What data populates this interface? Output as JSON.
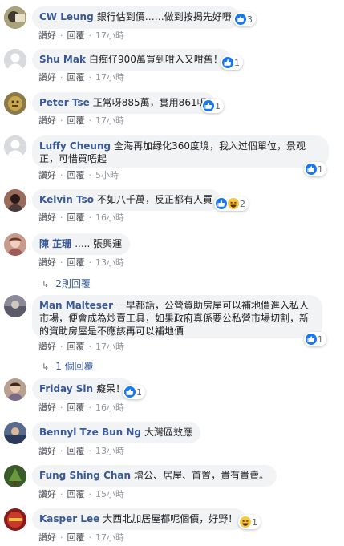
{
  "labels": {
    "like": "讚好",
    "reply": "回覆"
  },
  "comments": [
    {
      "author": "CW Leung",
      "text": "銀行估到價……做到按揭先好嘢",
      "time": "17小時",
      "reaction_count": "3"
    },
    {
      "author": "Shu Mak",
      "text": "白痴仔900萬買到咁入又咁舊！",
      "time": "17小時",
      "reaction_count": "1"
    },
    {
      "author": "Peter Tse",
      "text": "正常呀885萬，實用861呎",
      "time": "17小時",
      "reaction_count": "1"
    },
    {
      "author": "Luffy Cheung",
      "text": "全海再加绿化360度境，我入过個單位，景观正，可惜買唔起",
      "time": "5小時",
      "reaction_count": "1"
    },
    {
      "author": "Kelvin Tso",
      "text": "不如八千萬，反正都有人買",
      "time": "16小時",
      "reaction_count": "2"
    },
    {
      "author": "陳 芷珊",
      "text": "..... 張興運",
      "time": "13小時",
      "replies": "2則回覆"
    },
    {
      "author": "Man Malteser",
      "text": "一早都話，公營資助房屋可以補地價進入私人市場，便會成為炒賣工具，如果政府真係要公私營市場切割，新的資助房屋是不應該再可以補地價",
      "time": "17小時",
      "reaction_count": "1",
      "replies": "1 個回覆"
    },
    {
      "author": "Friday Sin",
      "text": "癡呆！",
      "time": "16小時",
      "reaction_count": "1"
    },
    {
      "author": "Bennyl Tze Bun Ng",
      "text": "大灣區效應",
      "time": "13小時"
    },
    {
      "author": "Fung Shing Chan",
      "text": "增公、居屋、首置，貴有貴賣。",
      "time": "15小時"
    },
    {
      "author": "Kasper Lee",
      "text": "大西北加居屋都呢個價，好野！",
      "time": "17小時",
      "reaction_count": "1"
    }
  ],
  "colors": {
    "author": "#385898",
    "bubble": "#f2f3f5",
    "like": "#1877f2",
    "haha": "#f7c843"
  }
}
